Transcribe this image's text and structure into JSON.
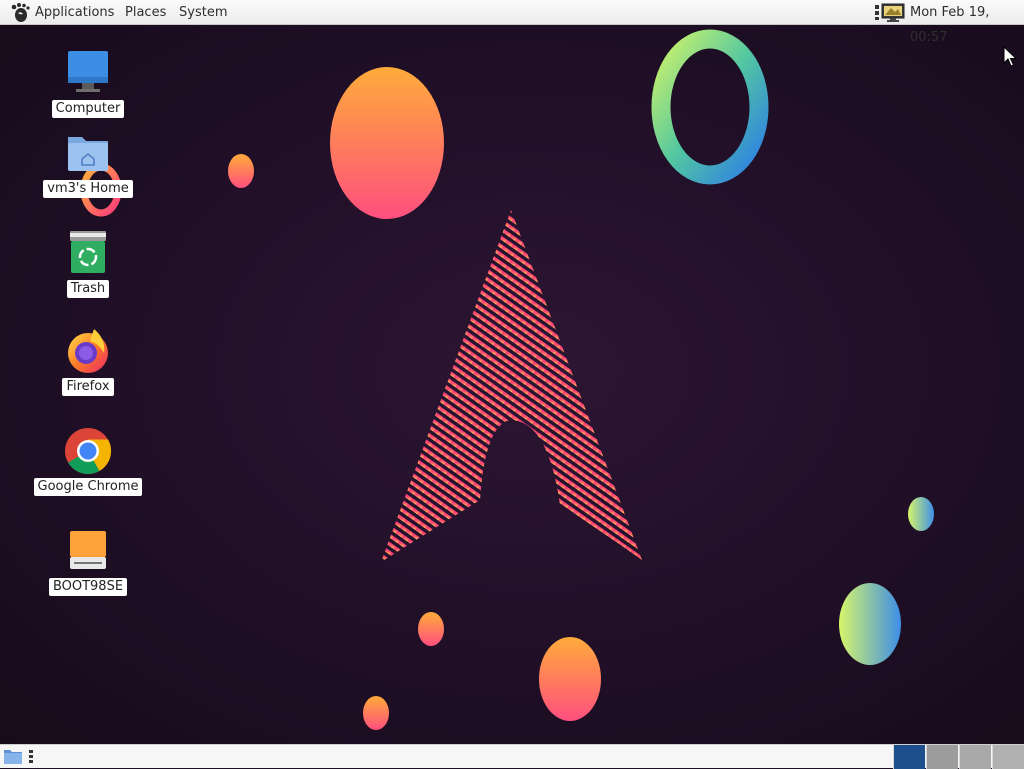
{
  "top_panel": {
    "menus": {
      "applications": "Applications",
      "places": "Places",
      "system": "System"
    },
    "clock": "Mon Feb 19, 00:57",
    "icons": {
      "main": "gnome-foot-icon",
      "tray_menu": "kebab-menu-icon",
      "tray_display": "display-settings-icon"
    }
  },
  "desktop_icons": [
    {
      "label": "Computer",
      "icon": "computer-icon"
    },
    {
      "label": "vm3's Home",
      "icon": "home-folder-icon"
    },
    {
      "label": "Trash",
      "icon": "trash-icon"
    },
    {
      "label": "Firefox",
      "icon": "firefox-icon"
    },
    {
      "label": "Google Chrome",
      "icon": "chrome-icon"
    },
    {
      "label": "BOOT98SE",
      "icon": "drive-icon"
    }
  ],
  "bottom_panel": {
    "icons": {
      "show_desktop": "show-desktop-icon",
      "menu": "kebab-menu-icon"
    },
    "workspaces": [
      {
        "name": "workspace-1",
        "active": true
      },
      {
        "name": "workspace-2",
        "active": false
      },
      {
        "name": "workspace-3",
        "active": false
      },
      {
        "name": "workspace-4",
        "active": false
      }
    ]
  },
  "colors": {
    "background": "#1e0f24",
    "panel": "#f4f4f4",
    "active_workspace": "#1c4f8c",
    "accent_pink": "#ff2f7a",
    "accent_orange": "#ffa53a",
    "accent_green": "#c9f06a",
    "accent_blue": "#3a8fe8"
  }
}
